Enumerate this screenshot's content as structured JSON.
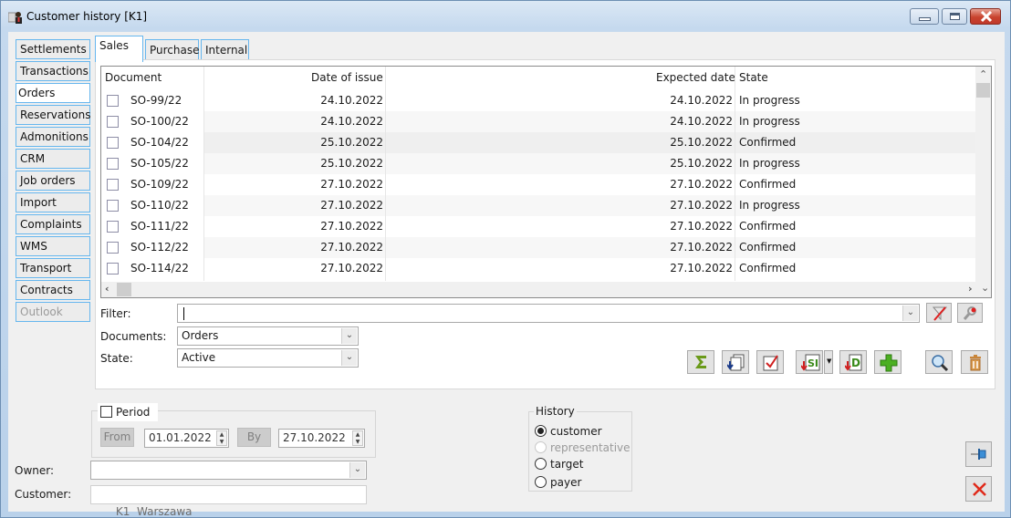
{
  "window": {
    "title": "Customer history [K1]",
    "controls": [
      "minimize",
      "maximize",
      "close"
    ]
  },
  "nav": {
    "items": [
      {
        "label": "Settlements",
        "active": false,
        "disabled": false
      },
      {
        "label": "Transactions",
        "active": false,
        "disabled": false
      },
      {
        "label": "Orders",
        "active": true,
        "disabled": false
      },
      {
        "label": "Reservations",
        "active": false,
        "disabled": false
      },
      {
        "label": "Admonitions",
        "active": false,
        "disabled": false
      },
      {
        "label": "CRM",
        "active": false,
        "disabled": false
      },
      {
        "label": "Job orders",
        "active": false,
        "disabled": false
      },
      {
        "label": "Import",
        "active": false,
        "disabled": false
      },
      {
        "label": "Complaints",
        "active": false,
        "disabled": false
      },
      {
        "label": "WMS",
        "active": false,
        "disabled": false
      },
      {
        "label": "Transport",
        "active": false,
        "disabled": false
      },
      {
        "label": "Contracts",
        "active": false,
        "disabled": false
      },
      {
        "label": "Outlook",
        "active": false,
        "disabled": true
      }
    ]
  },
  "tabs": [
    {
      "label": "Sales",
      "active": true
    },
    {
      "label": "Purchase",
      "active": false
    },
    {
      "label": "Internal",
      "active": false
    }
  ],
  "grid": {
    "columns": [
      "Document",
      "Date of issue",
      "Expected date",
      "State"
    ],
    "rows": [
      {
        "document": "SO-99/22",
        "date_of_issue": "24.10.2022",
        "expected_date": "24.10.2022",
        "state": "In progress"
      },
      {
        "document": "SO-100/22",
        "date_of_issue": "24.10.2022",
        "expected_date": "24.10.2022",
        "state": "In progress"
      },
      {
        "document": "SO-104/22",
        "date_of_issue": "25.10.2022",
        "expected_date": "25.10.2022",
        "state": "Confirmed"
      },
      {
        "document": "SO-105/22",
        "date_of_issue": "25.10.2022",
        "expected_date": "25.10.2022",
        "state": "In progress"
      },
      {
        "document": "SO-109/22",
        "date_of_issue": "27.10.2022",
        "expected_date": "27.10.2022",
        "state": "Confirmed"
      },
      {
        "document": "SO-110/22",
        "date_of_issue": "27.10.2022",
        "expected_date": "27.10.2022",
        "state": "In progress"
      },
      {
        "document": "SO-111/22",
        "date_of_issue": "27.10.2022",
        "expected_date": "27.10.2022",
        "state": "Confirmed"
      },
      {
        "document": "SO-112/22",
        "date_of_issue": "27.10.2022",
        "expected_date": "27.10.2022",
        "state": "Confirmed"
      },
      {
        "document": "SO-114/22",
        "date_of_issue": "27.10.2022",
        "expected_date": "27.10.2022",
        "state": "Confirmed"
      }
    ]
  },
  "filters": {
    "filter_label": "Filter:",
    "filter_value": "",
    "documents_label": "Documents:",
    "documents_value": "Orders",
    "state_label": "State:",
    "state_value": "Active"
  },
  "toolbar": {
    "buttons": [
      "sum-icon",
      "copy-documents-icon",
      "check-icon",
      "generate-si-icon",
      "generate-d-icon",
      "add-icon",
      "search-icon",
      "delete-icon"
    ]
  },
  "period": {
    "label": "Period",
    "checked": false,
    "from_label": "From",
    "from_value": "01.01.2022",
    "by_label": "By",
    "by_value": "27.10.2022"
  },
  "history": {
    "title": "History",
    "options": [
      {
        "label": "customer",
        "checked": true,
        "disabled": false
      },
      {
        "label": "representative",
        "checked": false,
        "disabled": true
      },
      {
        "label": "target",
        "checked": false,
        "disabled": false
      },
      {
        "label": "payer",
        "checked": false,
        "disabled": false
      }
    ]
  },
  "owner": {
    "label": "Owner:",
    "value": ""
  },
  "customer": {
    "label": "Customer:",
    "value": "K1  Warszawa"
  },
  "colors": {
    "tab_border": "#66b6ee",
    "close_red": "#c0392b",
    "add_green": "#4caf22",
    "sum_green": "#6a9a1a"
  }
}
